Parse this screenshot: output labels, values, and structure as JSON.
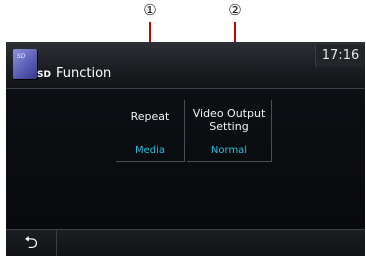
{
  "callouts": [
    {
      "label": "①"
    },
    {
      "label": "②"
    }
  ],
  "header": {
    "icon": "sd-card-icon",
    "sd_text": "SD",
    "sd_icon_text": "SD",
    "title": "Function",
    "clock": "17:16"
  },
  "menu": {
    "items": [
      {
        "label": "Repeat",
        "value": "Media"
      },
      {
        "label": "Video Output\nSetting",
        "value": "Normal"
      }
    ]
  },
  "footer": {
    "back_icon": "back-arrow-icon",
    "back_glyph": "⮌"
  },
  "colors": {
    "accent": "#29c0e0",
    "callout_line": "#c80000",
    "background": "#07090d"
  }
}
